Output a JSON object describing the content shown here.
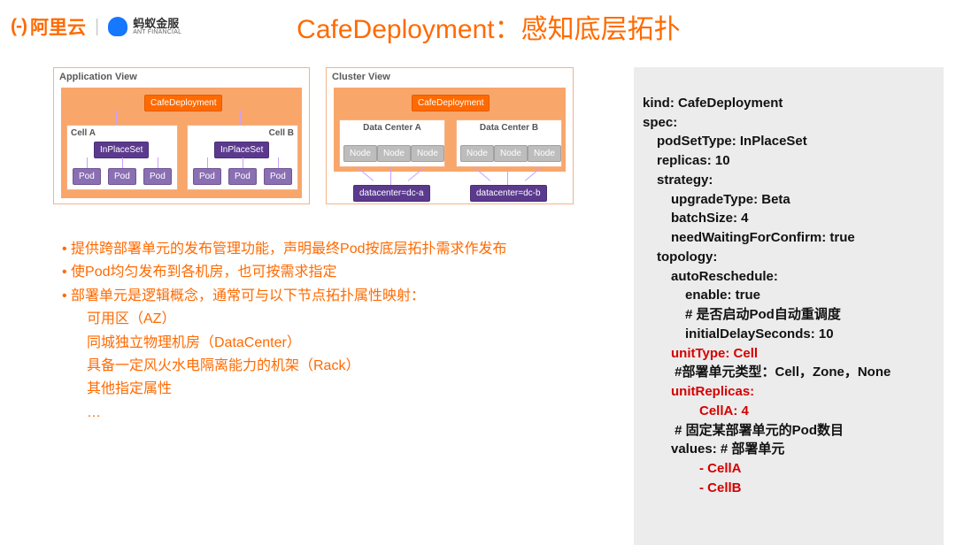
{
  "logos": {
    "aliyun": "阿里云",
    "ant_cn": "蚂蚁金服",
    "ant_en": "ANT FINANCIAL"
  },
  "title": "CafeDeployment：感知底层拓扑",
  "app_view": {
    "label": "Application View",
    "root": "CafeDeployment",
    "cell_a_label": "Cell A",
    "cell_b_label": "Cell B",
    "inplaceset": "InPlaceSet",
    "pod": "Pod"
  },
  "cluster_view": {
    "label": "Cluster View",
    "root": "CafeDeployment",
    "dc_a": "Data Center A",
    "dc_b": "Data Center B",
    "node": "Node",
    "tag_a": "datacenter=dc-a",
    "tag_b": "datacenter=dc-b"
  },
  "bullets": {
    "b1": "提供跨部署单元的发布管理功能，声明最终Pod按底层拓扑需求作发布",
    "b2": "使Pod均匀发布到各机房，也可按需求指定",
    "b3": "部署单元是逻辑概念，通常可与以下节点拓扑属性映射：",
    "s1": "可用区（AZ）",
    "s2": "同城独立物理机房（DataCenter）",
    "s3": "具备一定风火水电隔离能力的机架（Rack）",
    "s4": "其他指定属性",
    "s5": "…"
  },
  "code": {
    "l1": "kind: CafeDeployment",
    "l2": "spec:",
    "l3": "podSetType: InPlaceSet",
    "l4": "replicas: 10",
    "l5": "strategy:",
    "l6": "upgradeType: Beta",
    "l7": "batchSize: 4",
    "l8": "needWaitingForConfirm: true",
    "l9": "topology:",
    "l10": "autoReschedule:",
    "l11": "enable: true",
    "l12": "# 是否启动Pod自动重调度",
    "l13": "initialDelaySeconds: 10",
    "l14": "unitType: Cell",
    "l15": " #部署单元类型：Cell，Zone，None",
    "l16": "unitReplicas:",
    "l17": "CellA: 4",
    "l18": " # 固定某部署单元的Pod数目",
    "l19": "values: # 部署单元",
    "l20": "- CellA",
    "l21": "- CellB"
  }
}
